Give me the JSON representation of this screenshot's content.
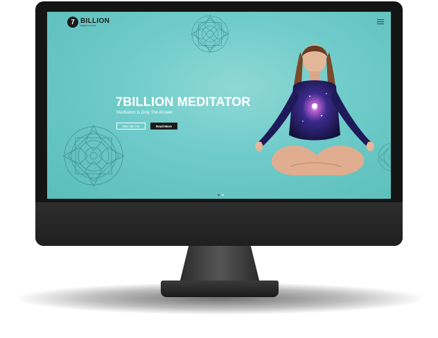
{
  "site": {
    "logo_mark": "7",
    "logo_word": "BILLION",
    "logo_sub": "MEDITATOR"
  },
  "hero": {
    "title": "7BILLION MEDITATOR",
    "subtitle": "Meditation Is Only The Answer",
    "btn_primary": "Who We Are",
    "btn_secondary": "Read More"
  },
  "slider": {
    "dots": 2,
    "active_index": 0
  },
  "icons": {
    "menu": "hamburger-menu-icon",
    "decor": "mandala-icon"
  },
  "colors": {
    "screen_bg": "#6ecbc9",
    "accent": "#2e7f7c",
    "button_dark": "#1a1a1a"
  }
}
